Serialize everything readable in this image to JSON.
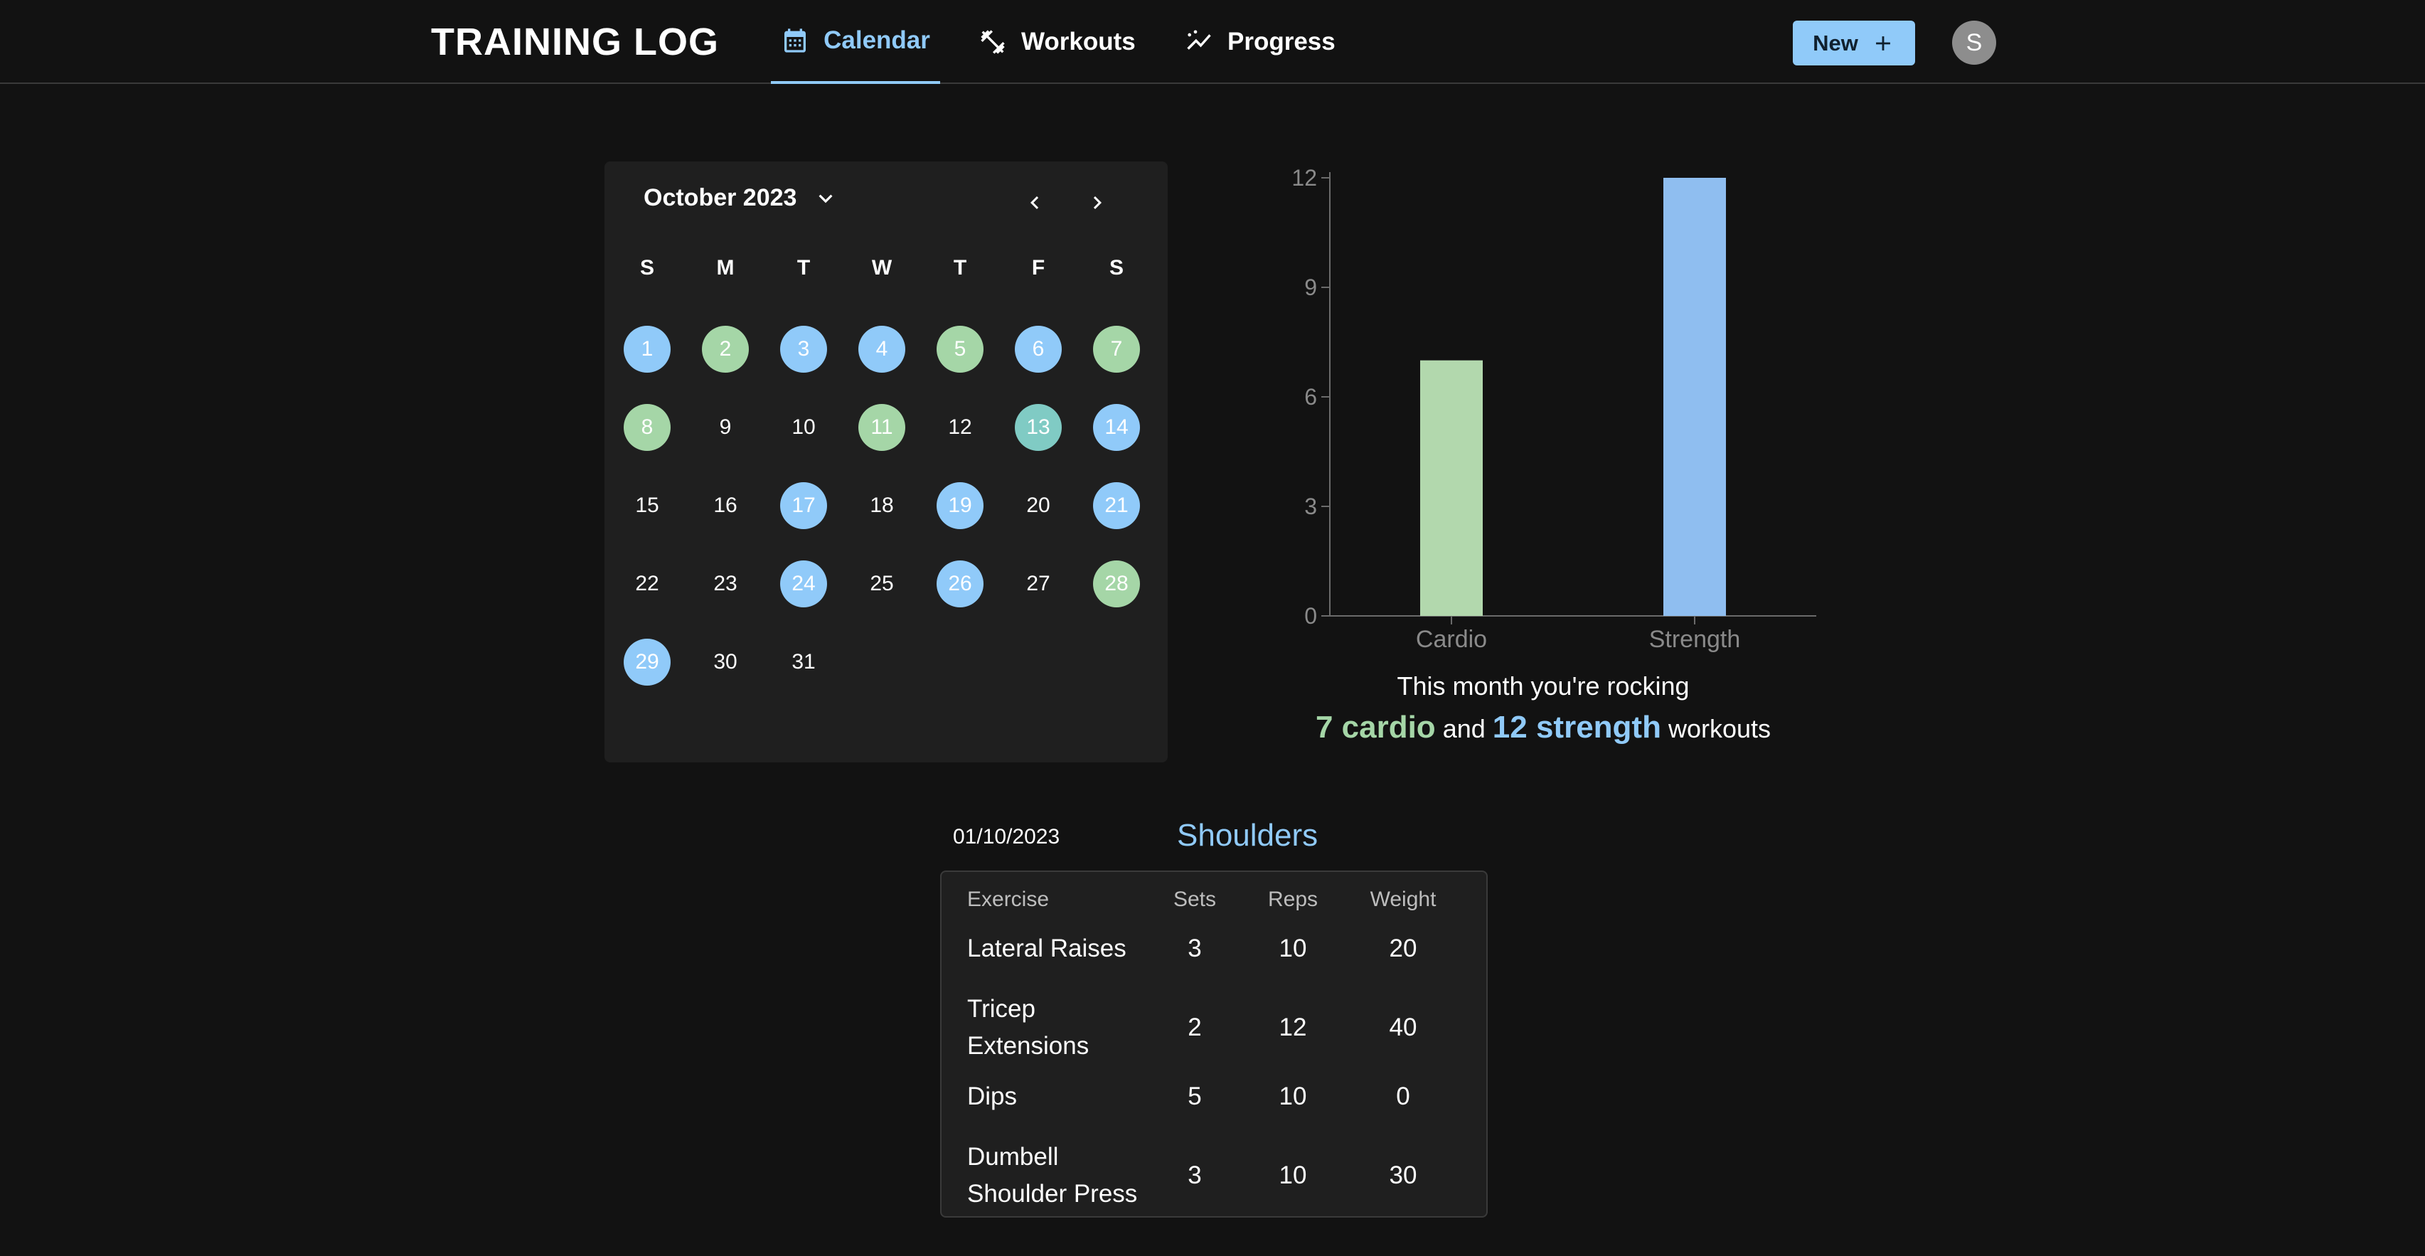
{
  "header": {
    "brand": "TRAINING LOG",
    "tabs": [
      {
        "label": "Calendar",
        "icon": "calendar-icon",
        "active": true
      },
      {
        "label": "Workouts",
        "icon": "dumbbell-icon",
        "active": false
      },
      {
        "label": "Progress",
        "icon": "trend-icon",
        "active": false
      }
    ],
    "new_label": "New",
    "avatar_initial": "S"
  },
  "calendar": {
    "month_label": "October 2023",
    "weekdays": [
      "S",
      "M",
      "T",
      "W",
      "T",
      "F",
      "S"
    ],
    "days": [
      {
        "d": "1",
        "type": "strength"
      },
      {
        "d": "2",
        "type": "cardio"
      },
      {
        "d": "3",
        "type": "strength"
      },
      {
        "d": "4",
        "type": "strength"
      },
      {
        "d": "5",
        "type": "cardio"
      },
      {
        "d": "6",
        "type": "strength"
      },
      {
        "d": "7",
        "type": "cardio"
      },
      {
        "d": "8",
        "type": "cardio"
      },
      {
        "d": "9",
        "type": ""
      },
      {
        "d": "10",
        "type": ""
      },
      {
        "d": "11",
        "type": "cardio"
      },
      {
        "d": "12",
        "type": ""
      },
      {
        "d": "13",
        "type": "both"
      },
      {
        "d": "14",
        "type": "strength"
      },
      {
        "d": "15",
        "type": ""
      },
      {
        "d": "16",
        "type": ""
      },
      {
        "d": "17",
        "type": "strength"
      },
      {
        "d": "18",
        "type": ""
      },
      {
        "d": "19",
        "type": "strength"
      },
      {
        "d": "20",
        "type": ""
      },
      {
        "d": "21",
        "type": "strength"
      },
      {
        "d": "22",
        "type": ""
      },
      {
        "d": "23",
        "type": ""
      },
      {
        "d": "24",
        "type": "strength"
      },
      {
        "d": "25",
        "type": ""
      },
      {
        "d": "26",
        "type": "strength"
      },
      {
        "d": "27",
        "type": ""
      },
      {
        "d": "28",
        "type": "cardio"
      },
      {
        "d": "29",
        "type": "strength"
      },
      {
        "d": "30",
        "type": ""
      },
      {
        "d": "31",
        "type": ""
      }
    ],
    "colors": {
      "cardio": "#a5d6a7",
      "strength": "#90caf9",
      "both": "#80cbc4"
    }
  },
  "chart_data": {
    "type": "bar",
    "categories": [
      "Cardio",
      "Strength"
    ],
    "values": [
      7,
      12
    ],
    "colors": [
      "#b2d8ad",
      "#8fbef0"
    ],
    "yticks": [
      0,
      3,
      6,
      9,
      12
    ],
    "ylim": [
      0,
      12
    ]
  },
  "summary": {
    "line1": "This month you're rocking",
    "cardio": "7 cardio",
    "and": "and",
    "strength": "12 strength",
    "workouts": "workouts"
  },
  "workout": {
    "date": "01/10/2023",
    "title": "Shoulders",
    "columns": [
      "Exercise",
      "Sets",
      "Reps",
      "Weight"
    ],
    "rows": [
      {
        "name": [
          "Lateral Raises"
        ],
        "sets": "3",
        "reps": "10",
        "weight": "20"
      },
      {
        "name": [
          "Tricep",
          "Extensions"
        ],
        "sets": "2",
        "reps": "12",
        "weight": "40"
      },
      {
        "name": [
          "Dips"
        ],
        "sets": "5",
        "reps": "10",
        "weight": "0"
      },
      {
        "name": [
          "Dumbell",
          "Shoulder Press"
        ],
        "sets": "3",
        "reps": "10",
        "weight": "30"
      }
    ]
  }
}
